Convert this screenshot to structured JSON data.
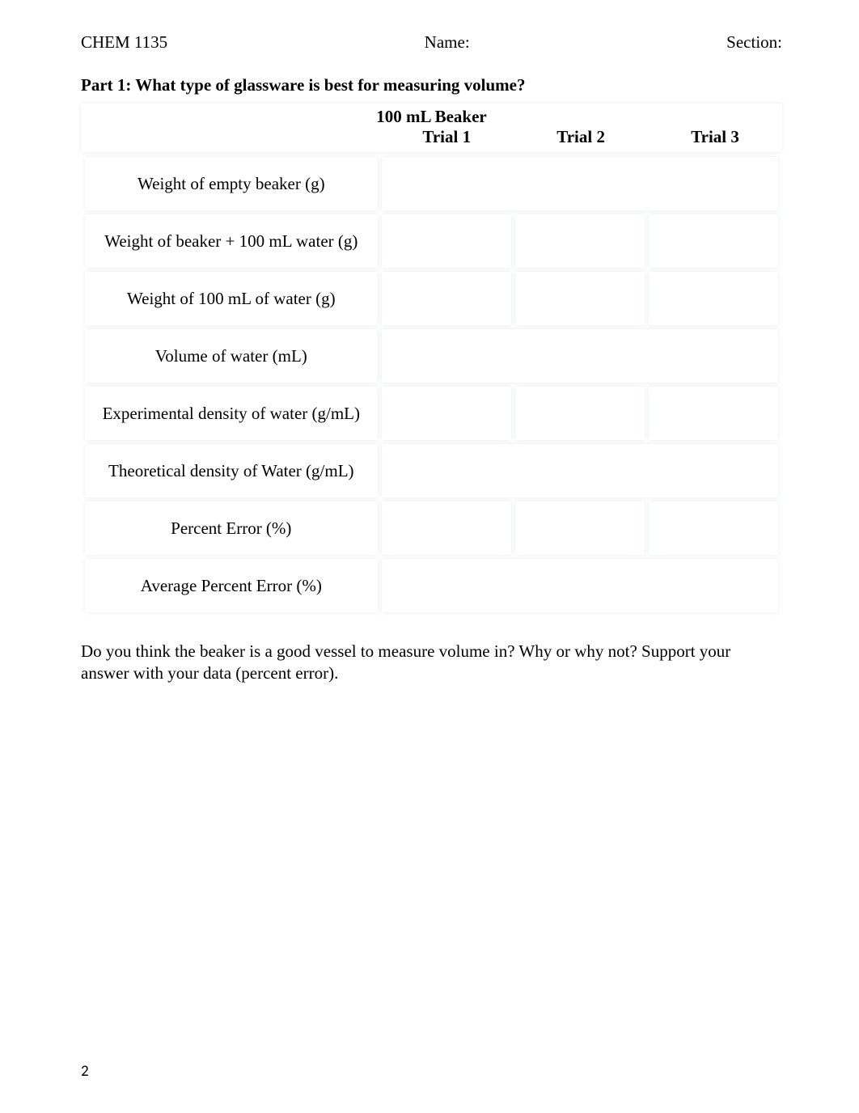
{
  "header": {
    "course": "CHEM 1135",
    "name_label": "Name:",
    "section_label": "Section:"
  },
  "part_title": "Part 1: What type of glassware is best for measuring volume?",
  "table": {
    "title": "100 mL Beaker",
    "columns": {
      "trial1": "Trial 1",
      "trial2": "Trial 2",
      "trial3": "Trial 3"
    },
    "rows": {
      "r1": {
        "label": "Weight of empty beaker (g)",
        "span": "wide",
        "t1": "",
        "t2": "",
        "t3": ""
      },
      "r2": {
        "label": "Weight of beaker + 100 mL water (g)",
        "span": "split",
        "t1": "",
        "t2": "",
        "t3": ""
      },
      "r3": {
        "label": "Weight of 100 mL of water (g)",
        "span": "split",
        "t1": "",
        "t2": "",
        "t3": ""
      },
      "r4": {
        "label": "Volume of water (mL)",
        "span": "wide",
        "t1": "",
        "t2": "",
        "t3": ""
      },
      "r5": {
        "label": "Experimental density of water (g/mL)",
        "span": "split",
        "t1": "",
        "t2": "",
        "t3": ""
      },
      "r6": {
        "label": "Theoretical density of Water (g/mL)",
        "span": "wide",
        "t1": "",
        "t2": "",
        "t3": ""
      },
      "r7": {
        "label": "Percent Error (%)",
        "span": "split",
        "t1": "",
        "t2": "",
        "t3": ""
      },
      "r8": {
        "label": "Average Percent Error (%)",
        "span": "wide",
        "t1": "",
        "t2": "",
        "t3": ""
      }
    }
  },
  "question": "Do you think the beaker is a good vessel to measure volume in? Why or why not? Support your answer with your data (percent error).",
  "page_number": "2"
}
